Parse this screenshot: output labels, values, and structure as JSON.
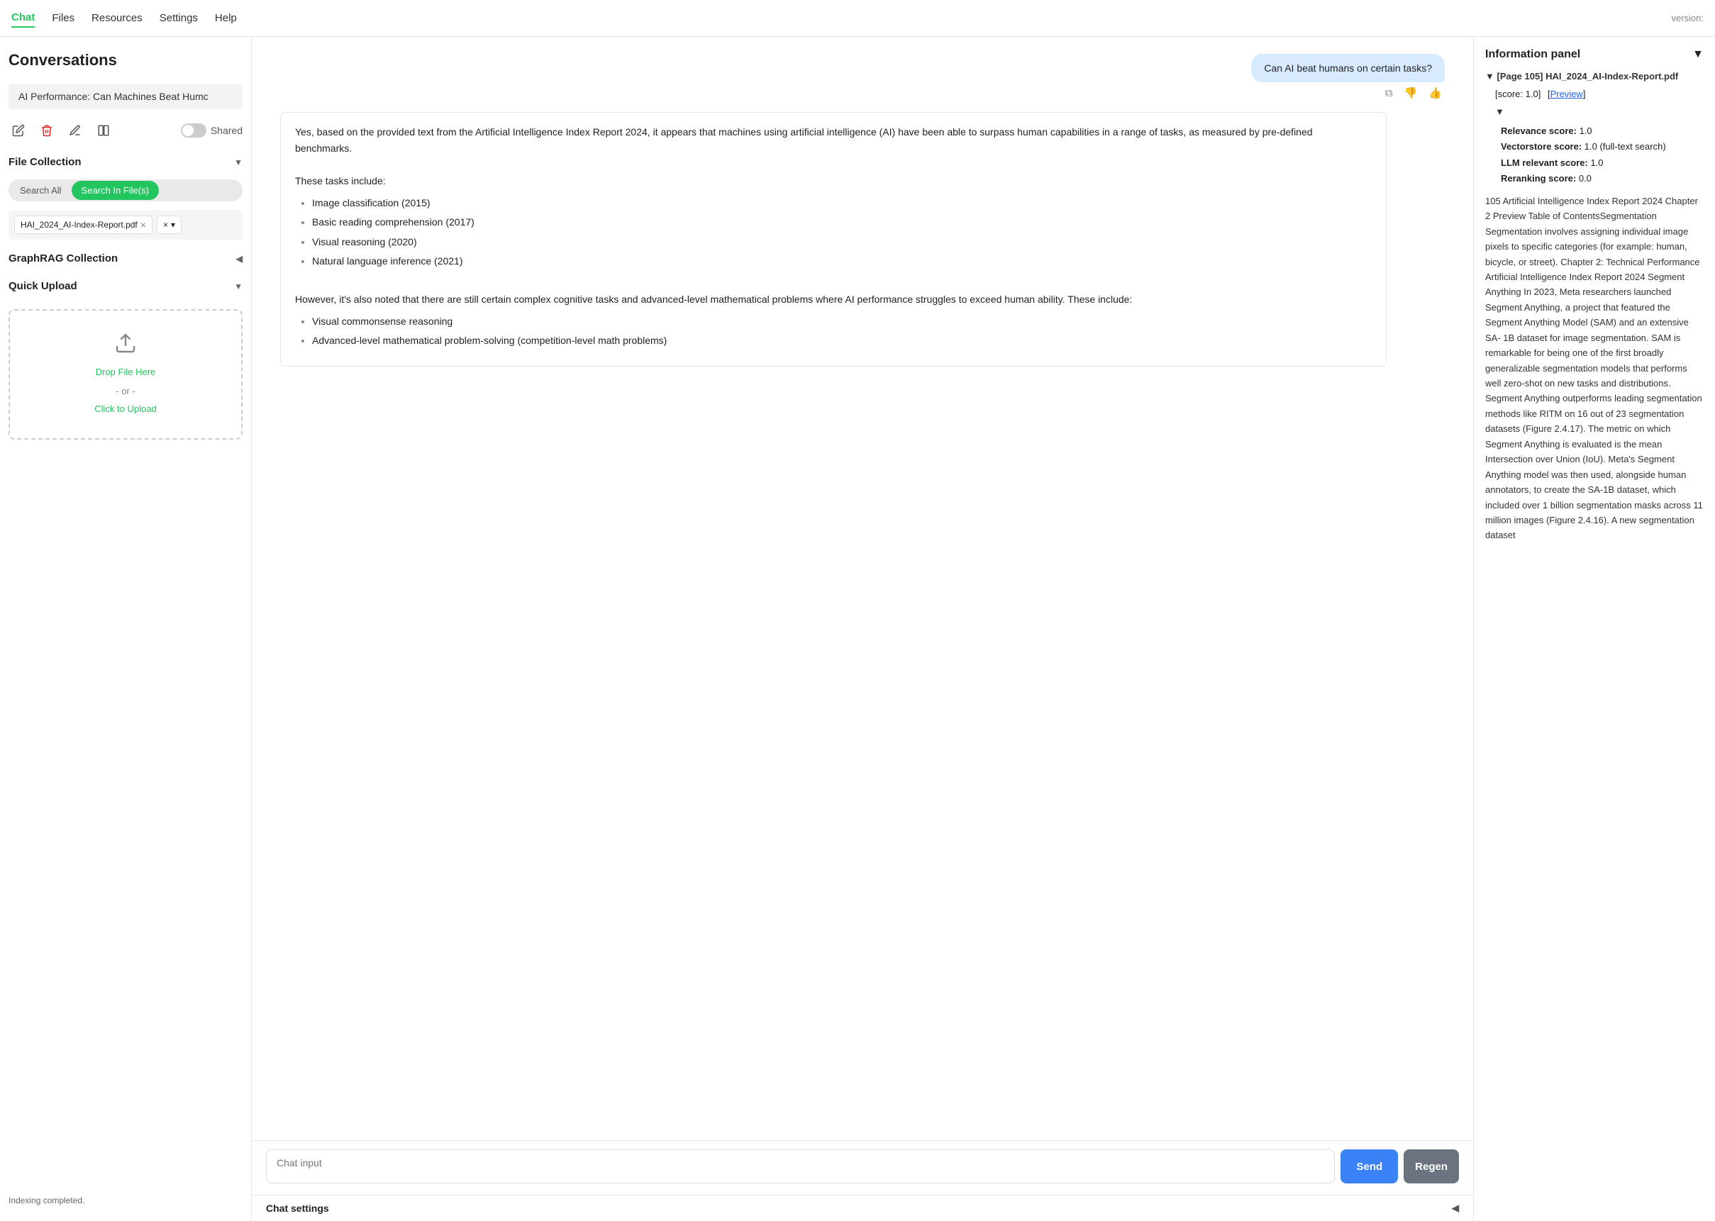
{
  "nav": {
    "items": [
      "Chat",
      "Files",
      "Resources",
      "Settings",
      "Help"
    ],
    "active": "Chat",
    "version": "version:"
  },
  "sidebar": {
    "title": "Conversations",
    "conversation": "AI Performance: Can Machines Beat Humc",
    "shared_label": "Shared",
    "icons": {
      "edit": "✏️",
      "delete": "🗑",
      "rename": "✎",
      "split": "⊟"
    },
    "file_collection": {
      "label": "File Collection",
      "search_all": "Search All",
      "search_in_files": "Search In File(s)",
      "active_search": "search_in_files",
      "files": [
        "HAI_2024_AI-Index-Report.pdf"
      ]
    },
    "graphrag": {
      "label": "GraphRAG Collection"
    },
    "quick_upload": {
      "label": "Quick Upload",
      "drop_text": "Drop File Here",
      "or_text": "- or -",
      "click_text": "Click to Upload"
    },
    "status": "Indexing completed."
  },
  "chat": {
    "user_message": "Can AI beat humans on certain tasks?",
    "assistant_message_intro": "Yes, based on the provided text from the Artificial Intelligence Index Report 2024, it appears that machines using artificial intelligence (AI) have been able to surpass human capabilities in a range of tasks, as measured by pre-defined benchmarks.",
    "tasks_label": "These tasks include:",
    "tasks": [
      "Image classification (2015)",
      "Basic reading comprehension (2017)",
      "Visual reasoning (2020)",
      "Natural language inference (2021)"
    ],
    "caveat_text": "However, it's also noted that there are still certain complex cognitive tasks and advanced-level mathematical problems where AI performance struggles to exceed human ability. These include:",
    "caveat_tasks": [
      "Visual commonsense reasoning",
      "Advanced-level mathematical problem-solving (competition-level math problems)"
    ],
    "input_placeholder": "Chat input",
    "send_label": "Send",
    "regen_label": "Regen",
    "settings_label": "Chat settings"
  },
  "info_panel": {
    "title": "Information panel",
    "source_file": "[Page 105] HAI_2024_AI-Index-Report.pdf",
    "score_text": "[score: 1.0]",
    "preview_label": "Preview",
    "relevance_score": "1.0",
    "vectorstore_score": "1.0 (full-text search)",
    "llm_score": "1.0",
    "reranking_score": "0.0",
    "body_text": "105 Artificial Intelligence Index Report 2024 Chapter 2 Preview Table of ContentsSegmentation Segmentation involves assigning individual image pixels to specific categories (for example: human, bicycle, or street). Chapter 2: Technical Performance Artificial Intelligence Index Report 2024 Segment Anything In 2023, Meta researchers launched Segment Anything, a project that featured the Segment Anything Model (SAM) and an extensive SA- 1B dataset for image segmentation. SAM is remarkable for being one of the first broadly generalizable segmentation models that performs well zero-shot on new tasks and distributions. Segment Anything outperforms leading segmentation methods like RITM on 16 out of 23 segmentation datasets (Figure 2.4.17). The metric on which Segment Anything is evaluated is the mean Intersection over Union (IoU). Meta's Segment Anything model was then used, alongside human annotators, to create the SA-1B dataset, which included over 1 billion segmentation masks across 11 million images (Figure 2.4.16). A new segmentation dataset"
  }
}
